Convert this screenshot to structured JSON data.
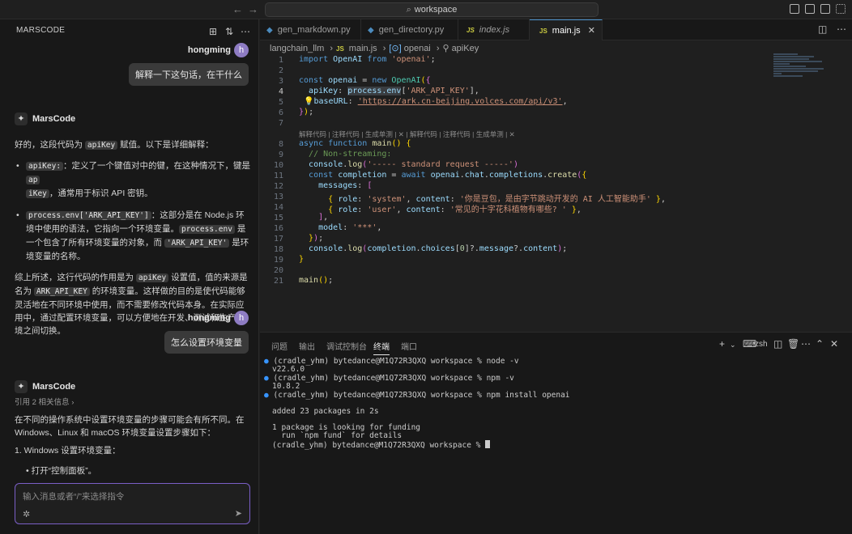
{
  "search": {
    "text": "workspace"
  },
  "left": {
    "title": "MARSCODE",
    "user1": {
      "name": "hongming",
      "avatar": "h",
      "message": "解释一下这句话，在干什么"
    },
    "bot_name": "MarsCode",
    "answer1": {
      "intro_a": "好的，这段代码为 ",
      "intro_code": "apiKey",
      "intro_b": " 赋值。以下是详细解释：",
      "b1_code_a": "apiKey:",
      "b1_text_a": "：定义了一个键值对中的键，在这种情况下，键是 ",
      "b1_code_b": "ap",
      "b1_code_c": "iKey",
      "b1_text_b": "，通常用于标识 API 密钥。",
      "b2_code_a": "process.env['ARK_API_KEY']",
      "b2_text_a": "：这部分是在 Node.js 环境中使用的语法，它指向一个环境变量。",
      "b2_code_b": "process.env",
      "b2_text_b": " 是一个包含了所有环境变量的对象，而 ",
      "b2_code_c": "'ARK_API_KEY'",
      "b2_text_c": " 是环境变量的名称。",
      "sum_a": "综上所述，这行代码的作用是为 ",
      "sum_code_a": "apiKey",
      "sum_b": " 设置值，值的来源是名为 ",
      "sum_code_b": "ARK_API_KEY",
      "sum_c": " 的环境变量。这样做的目的是使代码能够灵活地在不同环境中使用，而不需要修改代码本身。在实际应用中，通过配置环境变量，可以方便地在开发、测试和生产环境之间切换。"
    },
    "user2": {
      "name": "hongming",
      "avatar": "h",
      "message": "怎么设置环境变量"
    },
    "answer2": {
      "ref": "引用 2 相关信息 ›",
      "intro": "在不同的操作系统中设置环境变量的步骤可能会有所不同。在 Windows、Linux 和 macOS 环境变量设置步骤如下：",
      "item1": "1. Windows 设置环境变量：",
      "item2": "• 打开“控制面板”。"
    },
    "input_placeholder": "输入消息或者“/”来选择指令"
  },
  "tabs": [
    {
      "label": "gen_markdown.py",
      "lang": "py"
    },
    {
      "label": "gen_directory.py",
      "lang": "py"
    },
    {
      "label": "index.js",
      "lang": "js"
    },
    {
      "label": "main.js",
      "lang": "js"
    }
  ],
  "breadcrumb": {
    "folder": "langchain_llm",
    "file": "main.js",
    "obj": "openai",
    "prop": "apiKey"
  },
  "code_lens": "解释代码 | 注释代码 | 生成单测 | ✕ |  解释代码 | 注释代码 | 生成单测 | ✕",
  "panel": {
    "tabs": [
      "问题",
      "输出",
      "调试控制台",
      "终端",
      "端口"
    ],
    "shell": "zsh",
    "terminal": [
      "(cradle_yhm) bytedance@M1Q72R3QXQ workspace % node -v",
      "v22.6.0",
      "(cradle_yhm) bytedance@M1Q72R3QXQ workspace % npm -v",
      "10.8.2",
      "(cradle_yhm) bytedance@M1Q72R3QXQ workspace % npm install openai",
      "",
      "added 23 packages in 2s",
      "",
      "1 package is looking for funding",
      "  run `npm fund` for details",
      "(cradle_yhm) bytedance@M1Q72R3QXQ workspace % "
    ]
  }
}
